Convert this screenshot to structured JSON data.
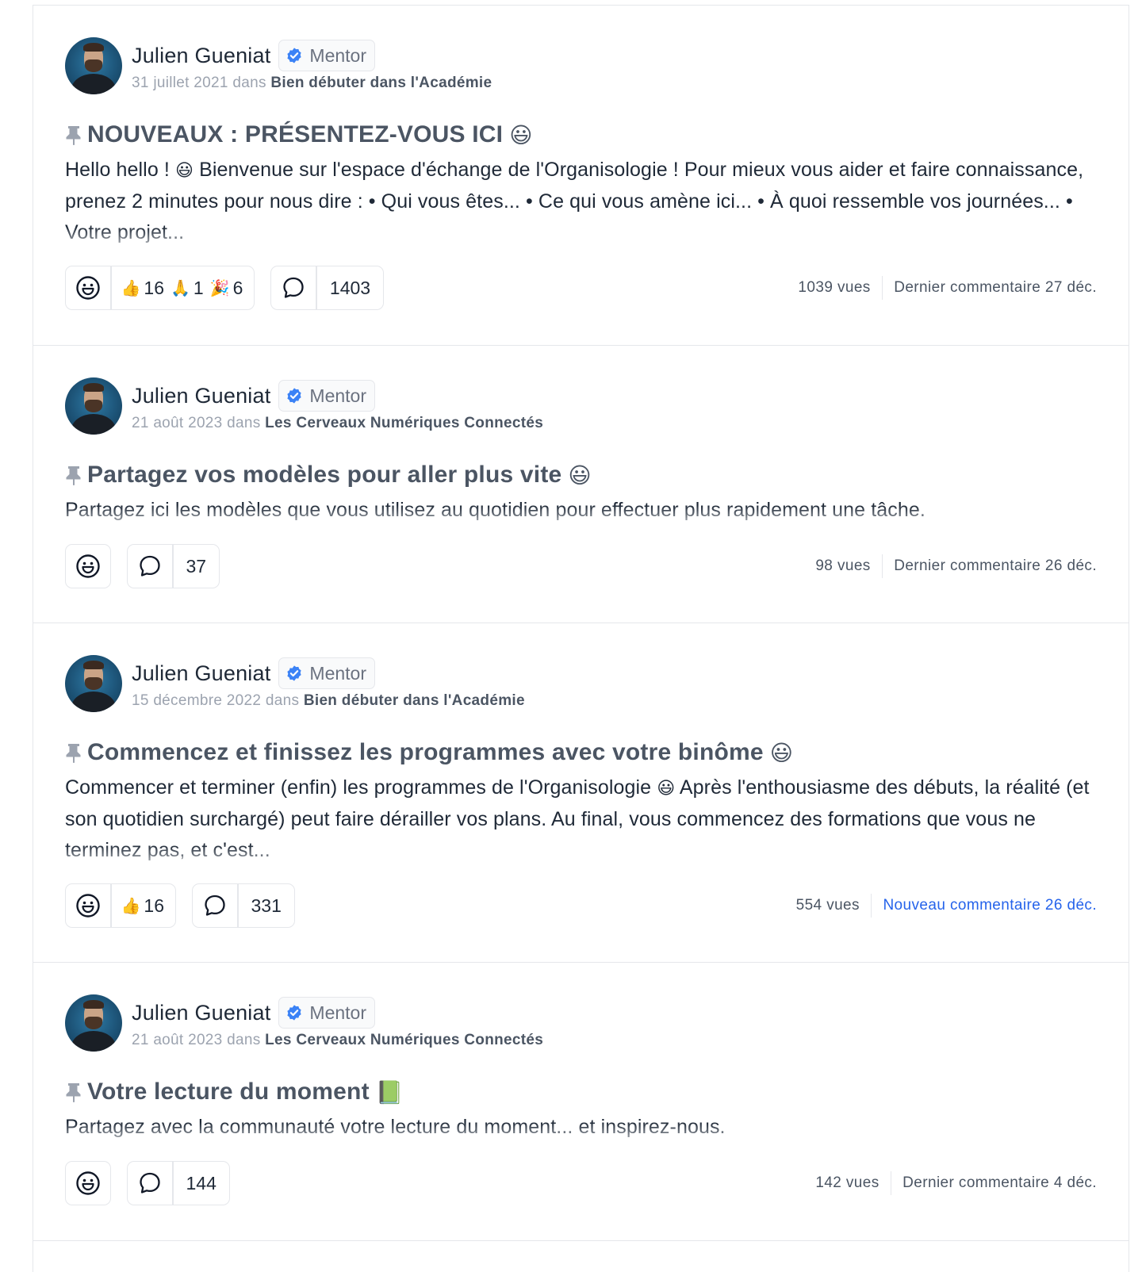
{
  "posts": [
    {
      "author": "Julien Gueniat",
      "badge": "Mentor",
      "date": "31 juillet 2021",
      "in_word": "dans",
      "space": "Bien débuter dans l'Académie",
      "title": "NOUVEAUX : PRÉSENTEZ-VOUS ICI",
      "title_emoji": "😃",
      "body_parts": [
        "Hello hello ! ",
        "😃",
        " Bienvenue sur l'espace d'échange de l'Organisologie ! Pour mieux vous aider et faire connaissance, prenez 2 minutes pour nous dire :  • Qui vous êtes... • Ce qui vous amène ici... • À quoi ressemble vos journées... • Votre projet..."
      ],
      "reactions": [
        {
          "emoji": "👍",
          "count": "16"
        },
        {
          "emoji": "🙏",
          "count": "1"
        },
        {
          "emoji": "🎉",
          "count": "6"
        }
      ],
      "comments": "1403",
      "views": "1039 vues",
      "last_comment": "Dernier commentaire 27 déc."
    },
    {
      "author": "Julien Gueniat",
      "badge": "Mentor",
      "date": "21 août 2023",
      "in_word": "dans",
      "space": "Les Cerveaux Numériques Connectés",
      "title": "Partagez vos modèles pour aller plus vite",
      "title_emoji": "😃",
      "body_parts": [
        "Partagez ici les modèles que vous utilisez au quotidien pour effectuer plus rapidement une tâche."
      ],
      "reactions": [],
      "comments": "37",
      "views": "98 vues",
      "last_comment": "Dernier commentaire 26 déc."
    },
    {
      "author": "Julien Gueniat",
      "badge": "Mentor",
      "date": "15 décembre 2022",
      "in_word": "dans",
      "space": "Bien débuter dans l'Académie",
      "title": "Commencez et finissez les programmes avec votre binôme",
      "title_emoji": "😃",
      "body_parts": [
        "Commencer et terminer (enfin) les programmes de l'Organisologie ",
        "😃",
        " Après l'enthousiasme des débuts, la réalité (et son quotidien surchargé) peut faire dérailler vos plans. Au final, vous commencez des formations que vous ne terminez pas, et c'est..."
      ],
      "reactions": [
        {
          "emoji": "👍",
          "count": "16"
        }
      ],
      "comments": "331",
      "views": "554 vues",
      "last_comment": "Nouveau commentaire 26 déc."
    },
    {
      "author": "Julien Gueniat",
      "badge": "Mentor",
      "date": "21 août 2023",
      "in_word": "dans",
      "space": "Les Cerveaux Numériques Connectés",
      "title": "Votre lecture du moment",
      "title_emoji": "📗",
      "body_parts": [
        "Partagez avec la communauté votre lecture du moment... et inspirez-nous."
      ],
      "reactions": [],
      "comments": "144",
      "views": "142 vues",
      "last_comment": "Dernier commentaire 4 déc."
    }
  ],
  "icons": {
    "pin": "pin-icon",
    "verified": "verified-check-icon",
    "add_reaction": "smiley-icon",
    "comment": "comment-bubble-icon"
  },
  "colors": {
    "verified": "#3b82f6",
    "new_comment": "#2563eb",
    "border": "#e5e7eb"
  }
}
